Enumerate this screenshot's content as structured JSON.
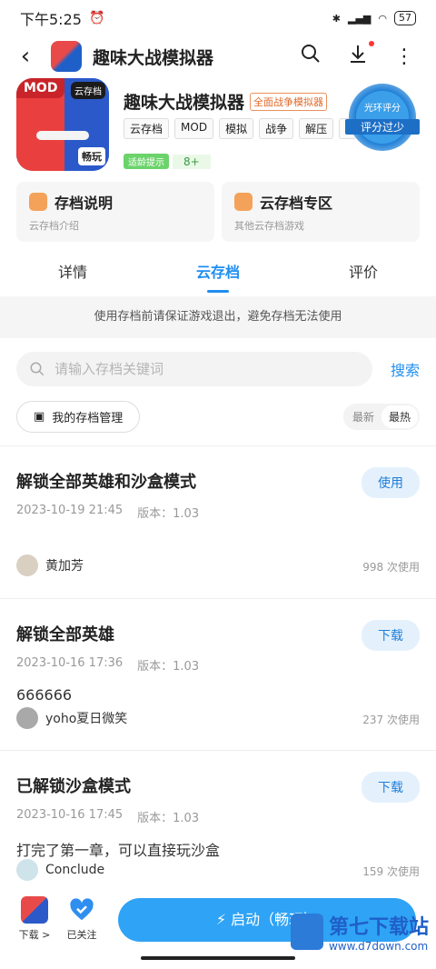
{
  "status": {
    "time": "下午5:25",
    "battery": "57"
  },
  "titlebar": {
    "title": "趣味大战模拟器"
  },
  "app": {
    "name": "趣味大战模拟器",
    "badge": "全面战争模拟器",
    "icon_labels": {
      "mod": "MOD",
      "cloud": "云存档",
      "fun": "畅玩"
    },
    "tags": [
      "云存档",
      "MOD",
      "模拟",
      "战争",
      "解压"
    ],
    "age_label": "适龄提示",
    "age": "8+",
    "rating_top": "光环评分",
    "rating_main": "评分过少"
  },
  "cards": [
    {
      "title": "存档说明",
      "sub": "云存档介绍"
    },
    {
      "title": "云存档专区",
      "sub": "其他云存档游戏"
    }
  ],
  "tabs": [
    "详情",
    "云存档",
    "评价"
  ],
  "notice": "使用存档前请保证游戏退出，避免存档无法使用",
  "search": {
    "placeholder": "请输入存档关键词",
    "button": "搜索"
  },
  "manage": {
    "label": "我的存档管理",
    "sort_newest": "最新",
    "sort_hottest": "最热"
  },
  "saves": [
    {
      "title": "解锁全部英雄和沙盒模式",
      "date": "2023-10-19 21:45",
      "version": "版本：1.03",
      "desc": "",
      "action": "使用",
      "user": "黄加芳",
      "uses": "998 次使用"
    },
    {
      "title": "解锁全部英雄",
      "date": "2023-10-16 17:36",
      "version": "版本：1.03",
      "desc": "666666",
      "action": "下载",
      "user": "yoho夏日微笑",
      "uses": "237 次使用"
    },
    {
      "title": "已解锁沙盒模式",
      "date": "2023-10-16 17:45",
      "version": "版本：1.03",
      "desc": "打完了第一章，可以直接玩沙盒",
      "action": "下载",
      "user": "Conclude",
      "uses": "159 次使用"
    }
  ],
  "bottom": {
    "download_label": "下载 >",
    "follow_label": "已关注",
    "launch": "启动（畅玩）"
  },
  "watermark": {
    "text": "第七下载站",
    "url": "www.d7down.com"
  },
  "colors": {
    "accent": "#1f8ef0",
    "launch": "#2fa3f5"
  }
}
